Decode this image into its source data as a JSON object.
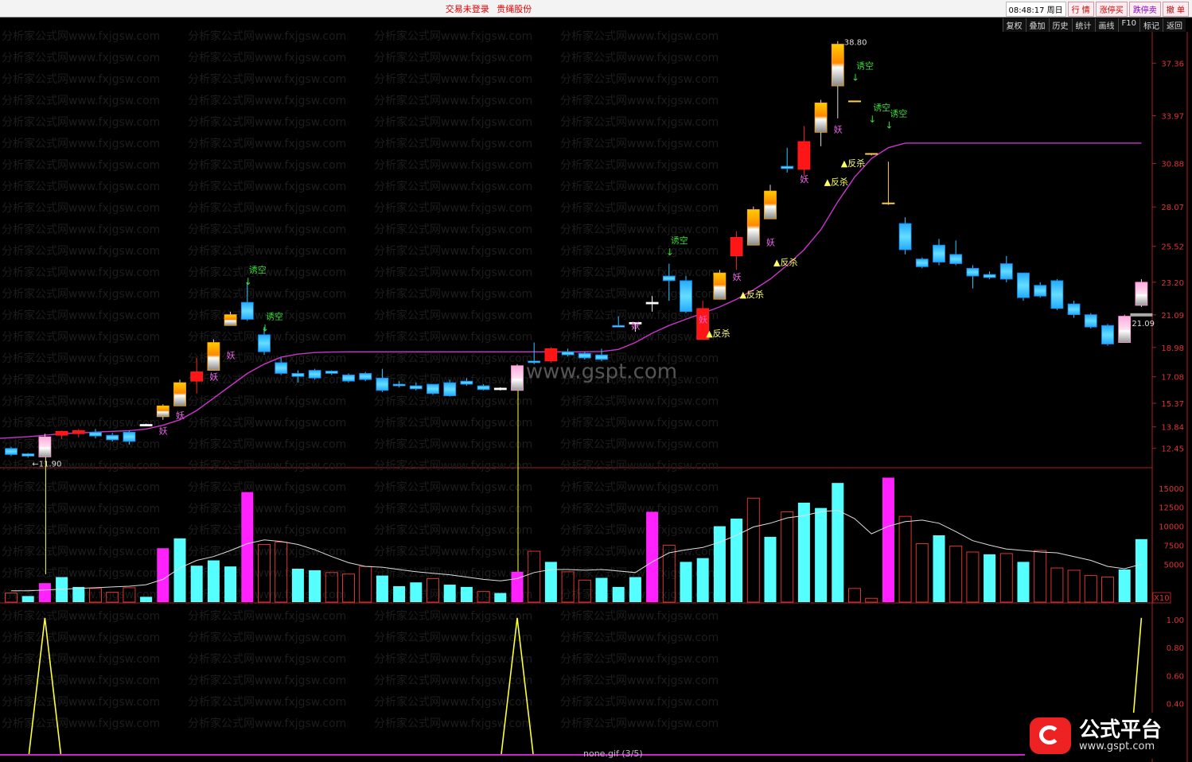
{
  "window": {
    "title_status": "交易未登录",
    "title_stock": "贵绳股份",
    "clock": "08:48:17 周日",
    "buttons": [
      "行 情",
      "涨停买",
      "跌停卖",
      "撤 单"
    ]
  },
  "toolbar": [
    "复权",
    "叠加",
    "历史",
    "统计",
    "画线",
    "F10",
    "标记",
    "返回"
  ],
  "footer": "none.gif (3/5)",
  "logo": {
    "name": "公式平台",
    "url": "www.gspt.com"
  },
  "watermark": {
    "text": "分析家公式网www.fxjgsw.com",
    "center": "www.gspt.com"
  },
  "colors": {
    "up_red": "#ff2020",
    "down_cyan": "#33ccff",
    "ma_magenta": "#cc33cc",
    "signal_yellow": "#ffff33",
    "text_green": "#33dd33"
  },
  "chart_data": [
    {
      "type": "candlestick",
      "ylim": [
        11.2,
        39.4
      ],
      "y_ticks": [
        "37.36",
        "33.97",
        "30.88",
        "28.07",
        "25.52",
        "23.20",
        "21.09",
        "18.98",
        "17.08",
        "15.37",
        "13.84",
        "12.45"
      ],
      "y_tick_values": [
        37.36,
        33.97,
        30.88,
        28.07,
        25.52,
        23.2,
        21.09,
        18.98,
        17.08,
        15.37,
        13.84,
        12.45
      ],
      "candles": [
        {
          "o": 12.45,
          "h": 12.55,
          "l": 11.95,
          "c": 12.05,
          "s": "down"
        },
        {
          "o": 12.1,
          "h": 12.15,
          "l": 11.85,
          "c": 11.95,
          "s": "down"
        },
        {
          "o": 11.9,
          "h": 13.4,
          "l": 11.9,
          "c": 13.2,
          "s": "pink"
        },
        {
          "o": 13.3,
          "h": 13.6,
          "l": 13.05,
          "c": 13.55,
          "s": "up"
        },
        {
          "o": 13.4,
          "h": 13.7,
          "l": 13.15,
          "c": 13.6,
          "s": "up"
        },
        {
          "o": 13.5,
          "h": 13.7,
          "l": 13.1,
          "c": 13.25,
          "s": "down"
        },
        {
          "o": 13.3,
          "h": 13.45,
          "l": 12.9,
          "c": 13.0,
          "s": "down"
        },
        {
          "o": 13.5,
          "h": 13.6,
          "l": 12.7,
          "c": 12.9,
          "s": "down"
        },
        {
          "o": 14.0,
          "h": 14.05,
          "l": 13.9,
          "c": 13.95,
          "s": "doji"
        },
        {
          "o": 14.5,
          "h": 15.3,
          "l": 14.3,
          "c": 15.2,
          "s": "orange"
        },
        {
          "o": 15.2,
          "h": 16.9,
          "l": 15.2,
          "c": 16.7,
          "s": "orange"
        },
        {
          "o": 16.8,
          "h": 18.3,
          "l": 16.0,
          "c": 17.4,
          "s": "up"
        },
        {
          "o": 17.5,
          "h": 19.5,
          "l": 17.5,
          "c": 19.3,
          "s": "orange"
        },
        {
          "o": 20.4,
          "h": 21.3,
          "l": 20.4,
          "c": 21.1,
          "s": "orange"
        },
        {
          "o": 21.9,
          "h": 23.2,
          "l": 20.7,
          "c": 20.8,
          "s": "down"
        },
        {
          "o": 19.8,
          "h": 20.3,
          "l": 18.5,
          "c": 18.7,
          "s": "down"
        },
        {
          "o": 18.0,
          "h": 18.3,
          "l": 17.2,
          "c": 17.3,
          "s": "down"
        },
        {
          "o": 17.3,
          "h": 17.5,
          "l": 16.7,
          "c": 17.1,
          "s": "down"
        },
        {
          "o": 17.5,
          "h": 17.6,
          "l": 16.9,
          "c": 17.0,
          "s": "down"
        },
        {
          "o": 17.45,
          "h": 17.5,
          "l": 17.2,
          "c": 17.3,
          "s": "down"
        },
        {
          "o": 17.2,
          "h": 17.3,
          "l": 16.7,
          "c": 16.8,
          "s": "down"
        },
        {
          "o": 17.3,
          "h": 17.4,
          "l": 16.8,
          "c": 16.9,
          "s": "down"
        },
        {
          "o": 17.0,
          "h": 17.6,
          "l": 16.1,
          "c": 16.2,
          "s": "down"
        },
        {
          "o": 16.6,
          "h": 16.8,
          "l": 16.4,
          "c": 16.5,
          "s": "down"
        },
        {
          "o": 16.5,
          "h": 16.7,
          "l": 16.2,
          "c": 16.3,
          "s": "down"
        },
        {
          "o": 16.6,
          "h": 16.6,
          "l": 15.9,
          "c": 16.0,
          "s": "down"
        },
        {
          "o": 16.7,
          "h": 16.9,
          "l": 15.8,
          "c": 15.85,
          "s": "down"
        },
        {
          "o": 16.8,
          "h": 17.0,
          "l": 16.5,
          "c": 16.6,
          "s": "down"
        },
        {
          "o": 16.5,
          "h": 16.6,
          "l": 16.2,
          "c": 16.25,
          "s": "down"
        },
        {
          "o": 16.35,
          "h": 16.4,
          "l": 16.2,
          "c": 16.3,
          "s": "doji"
        },
        {
          "o": 16.2,
          "h": 17.9,
          "l": 16.2,
          "c": 17.8,
          "s": "pink"
        },
        {
          "o": 18.0,
          "h": 19.3,
          "l": 17.9,
          "c": 18.1,
          "s": "down"
        },
        {
          "o": 18.1,
          "h": 19.0,
          "l": 18.0,
          "c": 18.9,
          "s": "up"
        },
        {
          "o": 18.7,
          "h": 18.9,
          "l": 18.4,
          "c": 18.5,
          "s": "down"
        },
        {
          "o": 18.6,
          "h": 18.7,
          "l": 18.2,
          "c": 18.3,
          "s": "down"
        },
        {
          "o": 18.5,
          "h": 18.9,
          "l": 18.1,
          "c": 18.2,
          "s": "down"
        },
        {
          "o": 20.3,
          "h": 21.0,
          "l": 20.3,
          "c": 20.4,
          "s": "down"
        },
        {
          "o": 20.6,
          "h": 20.6,
          "l": 20.0,
          "c": 20.6,
          "s": "doji"
        },
        {
          "o": 21.9,
          "h": 22.3,
          "l": 21.3,
          "c": 21.8,
          "s": "doji"
        },
        {
          "o": 23.6,
          "h": 24.4,
          "l": 22.0,
          "c": 23.3,
          "s": "down"
        },
        {
          "o": 23.3,
          "h": 23.6,
          "l": 21.2,
          "c": 21.3,
          "s": "down"
        },
        {
          "o": 19.5,
          "h": 22.0,
          "l": 19.5,
          "c": 21.5,
          "s": "up"
        },
        {
          "o": 22.1,
          "h": 24.0,
          "l": 22.1,
          "c": 23.8,
          "s": "orange"
        },
        {
          "o": 24.9,
          "h": 26.5,
          "l": 24.0,
          "c": 26.1,
          "s": "up"
        },
        {
          "o": 25.6,
          "h": 28.1,
          "l": 25.6,
          "c": 27.9,
          "s": "orange"
        },
        {
          "o": 27.3,
          "h": 29.5,
          "l": 27.3,
          "c": 29.1,
          "s": "orange"
        },
        {
          "o": 30.55,
          "h": 31.9,
          "l": 30.3,
          "c": 30.7,
          "s": "down"
        },
        {
          "o": 30.5,
          "h": 33.3,
          "l": 30.1,
          "c": 32.3,
          "s": "up"
        },
        {
          "o": 32.9,
          "h": 35.0,
          "l": 32.0,
          "c": 34.8,
          "s": "orange"
        },
        {
          "o": 35.9,
          "h": 38.8,
          "l": 33.8,
          "c": 38.6,
          "s": "orange"
        },
        {
          "o": 34.9,
          "h": 34.9,
          "l": 34.9,
          "c": 34.9,
          "s": "dash"
        },
        {
          "o": 31.5,
          "h": 31.5,
          "l": 31.4,
          "c": 31.5,
          "s": "dash"
        },
        {
          "o": 28.3,
          "h": 31.0,
          "l": 28.2,
          "c": 28.3,
          "s": "dash"
        },
        {
          "o": 27.0,
          "h": 27.4,
          "l": 25.0,
          "c": 25.3,
          "s": "down"
        },
        {
          "o": 24.7,
          "h": 24.8,
          "l": 24.1,
          "c": 24.2,
          "s": "down"
        },
        {
          "o": 25.6,
          "h": 26.0,
          "l": 24.3,
          "c": 24.5,
          "s": "down"
        },
        {
          "o": 25.0,
          "h": 25.9,
          "l": 24.3,
          "c": 24.4,
          "s": "down"
        },
        {
          "o": 24.1,
          "h": 24.3,
          "l": 22.8,
          "c": 23.6,
          "s": "down"
        },
        {
          "o": 23.7,
          "h": 23.9,
          "l": 23.4,
          "c": 23.5,
          "s": "down"
        },
        {
          "o": 24.4,
          "h": 24.9,
          "l": 23.2,
          "c": 23.4,
          "s": "down"
        },
        {
          "o": 23.8,
          "h": 23.8,
          "l": 22.0,
          "c": 22.2,
          "s": "down"
        },
        {
          "o": 23.0,
          "h": 23.2,
          "l": 22.2,
          "c": 22.3,
          "s": "down"
        },
        {
          "o": 23.3,
          "h": 23.4,
          "l": 21.4,
          "c": 21.5,
          "s": "down"
        },
        {
          "o": 21.8,
          "h": 22.0,
          "l": 20.9,
          "c": 21.1,
          "s": "down"
        },
        {
          "o": 21.1,
          "h": 21.2,
          "l": 20.2,
          "c": 20.3,
          "s": "down"
        },
        {
          "o": 20.4,
          "h": 20.5,
          "l": 19.1,
          "c": 19.2,
          "s": "down"
        },
        {
          "o": 19.3,
          "h": 21.1,
          "l": 19.3,
          "c": 21.0,
          "s": "pink"
        },
        {
          "o": 21.7,
          "h": 23.4,
          "l": 21.6,
          "c": 23.2,
          "s": "pink"
        }
      ],
      "ma_line": [
        13.1,
        13.2,
        13.3,
        13.4,
        13.45,
        13.5,
        13.55,
        13.6,
        13.7,
        13.95,
        14.3,
        14.9,
        15.7,
        16.5,
        17.3,
        17.9,
        18.35,
        18.55,
        18.65,
        18.68,
        18.7,
        18.7,
        18.7,
        18.7,
        18.7,
        18.7,
        18.7,
        18.7,
        18.7,
        18.7,
        18.7,
        18.7,
        18.7,
        18.7,
        18.7,
        18.72,
        18.85,
        19.3,
        19.9,
        20.4,
        20.8,
        21.2,
        21.6,
        22.1,
        22.7,
        23.4,
        24.3,
        25.3,
        26.6,
        28.4,
        30.0,
        31.2,
        31.9,
        32.2,
        32.2,
        32.2,
        32.2,
        32.2,
        32.2,
        32.2,
        32.2,
        32.2,
        32.2,
        32.2,
        32.2,
        32.2,
        32.2,
        32.2
      ],
      "labels": [
        {
          "i": 2,
          "text": "←11.90",
          "kind": "low",
          "price": 11.9
        },
        {
          "i": 49,
          "text": "38.80",
          "kind": "high",
          "price": 38.8
        },
        {
          "i": 67,
          "text": "21.09",
          "kind": "last",
          "price": 21.09
        },
        {
          "i": 14,
          "text": "诱空",
          "kind": "sell",
          "price": 23.5
        },
        {
          "i": 15,
          "text": "诱空",
          "kind": "sell",
          "price": 20.5
        },
        {
          "i": 39,
          "text": "诱空",
          "kind": "sell",
          "price": 25.4
        },
        {
          "i": 50,
          "text": "诱空",
          "kind": "sell",
          "price": 36.7
        },
        {
          "i": 51,
          "text": "诱空",
          "kind": "sell",
          "price": 34.0
        },
        {
          "i": 52,
          "text": "诱空",
          "kind": "sell",
          "price": 33.6
        },
        {
          "i": 9,
          "text": "妖",
          "kind": "yao",
          "price": 14.0
        },
        {
          "i": 10,
          "text": "妖",
          "kind": "yao",
          "price": 15.0
        },
        {
          "i": 12,
          "text": "妖",
          "kind": "yao",
          "price": 17.5
        },
        {
          "i": 13,
          "text": "妖",
          "kind": "yao",
          "price": 18.9
        },
        {
          "i": 37,
          "text": "妖",
          "kind": "yao",
          "price": 20.8
        },
        {
          "i": 41,
          "text": "妖",
          "kind": "yao",
          "price": 21.2
        },
        {
          "i": 43,
          "text": "妖",
          "kind": "yao",
          "price": 23.95
        },
        {
          "i": 45,
          "text": "妖",
          "kind": "yao",
          "price": 26.2
        },
        {
          "i": 47,
          "text": "妖",
          "kind": "yao",
          "price": 30.3
        },
        {
          "i": 49,
          "text": "妖",
          "kind": "yao",
          "price": 33.5
        },
        {
          "i": 41,
          "text": "▲反杀",
          "kind": "fansha",
          "price": 19.7
        },
        {
          "i": 43,
          "text": "▲反杀",
          "kind": "fansha",
          "price": 22.2
        },
        {
          "i": 45,
          "text": "▲反杀",
          "kind": "fansha",
          "price": 24.3
        },
        {
          "i": 48,
          "text": "▲反杀",
          "kind": "fansha",
          "price": 29.5
        },
        {
          "i": 49,
          "text": "▲反杀",
          "kind": "fansha",
          "price": 30.7
        }
      ],
      "signal_lines": [
        2,
        30
      ]
    },
    {
      "type": "bar",
      "title": "volume",
      "ylim": [
        0,
        17500
      ],
      "y_ticks": [
        "15000",
        "12500",
        "10000",
        "7500",
        "5000"
      ],
      "y_tick_values": [
        15000,
        12500,
        10000,
        7500,
        5000
      ],
      "unit_label": "X10",
      "values": [
        1200,
        800,
        2500,
        3300,
        2000,
        1800,
        1300,
        1900,
        700,
        7100,
        8400,
        4800,
        5500,
        4700,
        14500,
        7600,
        7900,
        4400,
        4200,
        3900,
        3700,
        4700,
        3500,
        2100,
        2600,
        3100,
        2300,
        2000,
        1400,
        1200,
        4000,
        6700,
        5300,
        4000,
        2900,
        3200,
        2000,
        3300,
        11900,
        7500,
        5300,
        5800,
        10000,
        11000,
        13700,
        8600,
        11900,
        13100,
        12400,
        15700,
        1800,
        500,
        16400,
        11300,
        7700,
        8800,
        7400,
        6600,
        6300,
        6400,
        5300,
        6800,
        4500,
        4200,
        3500,
        3300,
        4300,
        8300
      ],
      "colors": [
        "down",
        "up",
        "pink",
        "up",
        "up",
        "down",
        "down",
        "down",
        "up",
        "magenta",
        "up",
        "up",
        "up",
        "up",
        "magenta",
        "down",
        "down",
        "up",
        "up",
        "down",
        "down",
        "down",
        "up",
        "up",
        "up",
        "down",
        "up",
        "up",
        "down",
        "up",
        "pink",
        "down",
        "up",
        "down",
        "down",
        "up",
        "up",
        "up",
        "magenta",
        "down",
        "up",
        "up",
        "up",
        "up",
        "down",
        "up",
        "down",
        "up",
        "up",
        "up",
        "down",
        "down",
        "magenta",
        "down",
        "down",
        "up",
        "down",
        "down",
        "up",
        "down",
        "up",
        "down",
        "down",
        "down",
        "down",
        "down",
        "up",
        "up"
      ],
      "ma": [
        1500,
        1500,
        1600,
        1700,
        1800,
        1900,
        2000,
        2100,
        2300,
        3000,
        4500,
        5500,
        6000,
        6800,
        7700,
        8200,
        8000,
        7600,
        6900,
        6000,
        5200,
        4700,
        4600,
        4300,
        4000,
        3800,
        3600,
        3300,
        3000,
        2800,
        3100,
        3900,
        4300,
        4300,
        4200,
        4300,
        4100,
        3900,
        5300,
        6500,
        6900,
        7200,
        7900,
        8800,
        9900,
        10400,
        11100,
        11400,
        11900,
        12100,
        11000,
        9000,
        10000,
        10600,
        10800,
        10400,
        9300,
        8100,
        7500,
        7000,
        6800,
        6600,
        6500,
        6000,
        5500,
        4700,
        4400,
        5000
      ]
    },
    {
      "type": "line",
      "title": "signal",
      "ylim": [
        0.2,
        1.05
      ],
      "y_ticks": [
        "1.00",
        "0.80",
        "0.60",
        "0.40"
      ],
      "y_tick_values": [
        1.0,
        0.8,
        0.6,
        0.4
      ],
      "peaks": [
        2,
        30,
        67
      ],
      "values": [
        0,
        0,
        1,
        0,
        0,
        0,
        0,
        0,
        0,
        0,
        0,
        0,
        0,
        0,
        0,
        0,
        0,
        0,
        0,
        0,
        0,
        0,
        0,
        0,
        0,
        0,
        0,
        0,
        0,
        0,
        1,
        0,
        0,
        0,
        0,
        0,
        0,
        0,
        0,
        0,
        0,
        0,
        0,
        0,
        0,
        0,
        0,
        0,
        0,
        0,
        0,
        0,
        0,
        0,
        0,
        0,
        0,
        0,
        0,
        0,
        0,
        0,
        0,
        0,
        0,
        0,
        0,
        1
      ]
    }
  ]
}
